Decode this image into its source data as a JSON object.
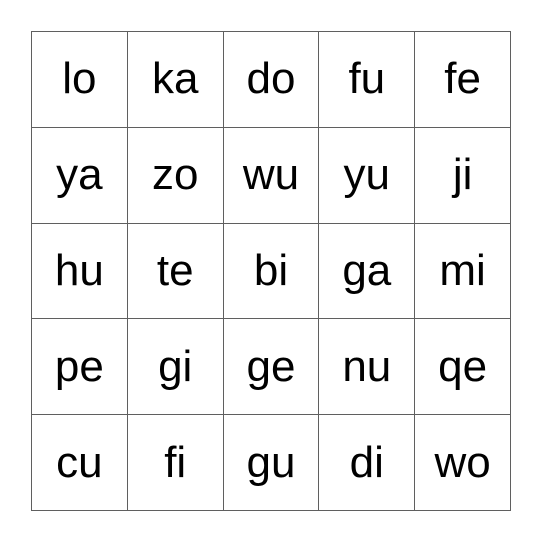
{
  "card": {
    "type": "bingo-card",
    "grid": {
      "rows": 5,
      "columns": 5
    },
    "colors": {
      "page_background": "#ffffff",
      "cell_background": "#ffffff",
      "grid_line": "#5f5f5f",
      "text": "#000000"
    },
    "cells": [
      [
        {
          "label": "lo"
        },
        {
          "label": "ka"
        },
        {
          "label": "do"
        },
        {
          "label": "fu"
        },
        {
          "label": "fe"
        }
      ],
      [
        {
          "label": "ya"
        },
        {
          "label": "zo"
        },
        {
          "label": "wu"
        },
        {
          "label": "yu"
        },
        {
          "label": "ji"
        }
      ],
      [
        {
          "label": "hu"
        },
        {
          "label": "te"
        },
        {
          "label": "bi"
        },
        {
          "label": "ga"
        },
        {
          "label": "mi"
        }
      ],
      [
        {
          "label": "pe"
        },
        {
          "label": "gi"
        },
        {
          "label": "ge"
        },
        {
          "label": "nu"
        },
        {
          "label": "qe"
        }
      ],
      [
        {
          "label": "cu"
        },
        {
          "label": "fi"
        },
        {
          "label": "gu"
        },
        {
          "label": "di"
        },
        {
          "label": "wo"
        }
      ]
    ]
  }
}
